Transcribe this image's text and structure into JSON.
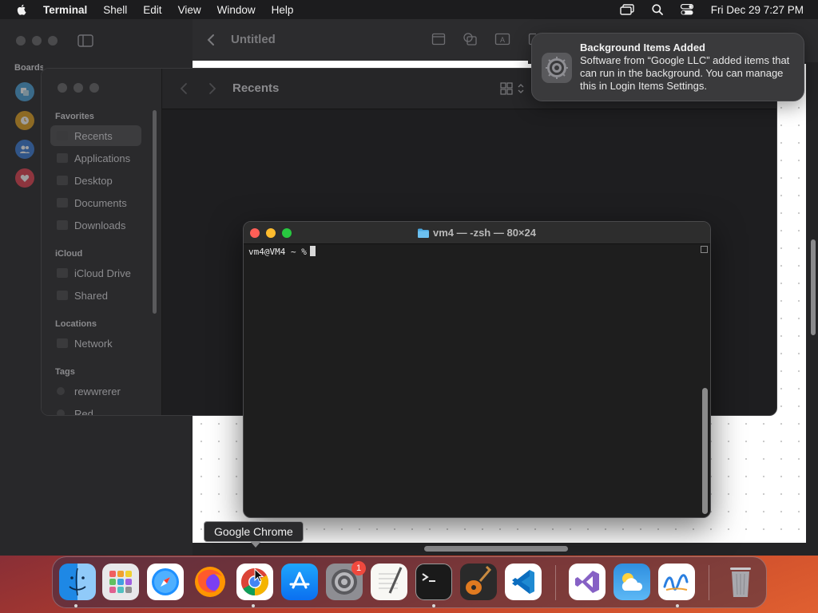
{
  "menubar": {
    "app_name": "Terminal",
    "menus": [
      "Shell",
      "Edit",
      "View",
      "Window",
      "Help"
    ],
    "clock": "Fri Dec 29  7:27 PM"
  },
  "freeform": {
    "title": "Untitled",
    "sidebar_label": "Boards"
  },
  "finder": {
    "title": "Recents",
    "sections": {
      "favorites": "Favorites",
      "icloud": "iCloud",
      "locations": "Locations",
      "tags": "Tags"
    },
    "favorites": [
      "Recents",
      "Applications",
      "Desktop",
      "Documents",
      "Downloads"
    ],
    "icloud_items": [
      "iCloud Drive",
      "Shared"
    ],
    "locations_items": [
      "Network"
    ],
    "tags_items": [
      "rewwrerer",
      "Red"
    ]
  },
  "terminal": {
    "title": "vm4 — -zsh — 80×24",
    "prompt": "vm4@VM4 ~ %"
  },
  "notification": {
    "title": "Background Items Added",
    "body": "Software from “Google LLC” added items that can run in the background. You can manage this in Login Items Settings."
  },
  "tooltip": "Google Chrome",
  "dock": {
    "badge_count": "1",
    "apps": [
      "finder-icon",
      "launchpad-icon",
      "safari-icon",
      "firefox-icon",
      "chrome-icon",
      "app-store-icon",
      "system-settings-icon",
      "textedit-icon",
      "terminal-icon",
      "garageband-icon",
      "vscode-icon",
      "visual-studio-icon",
      "weather-icon",
      "freeform-icon",
      "trash-icon"
    ]
  },
  "colors": {
    "close": "#fe5f57",
    "minimize": "#febc2e",
    "zoom": "#28c840",
    "badge": "#f0493e"
  }
}
